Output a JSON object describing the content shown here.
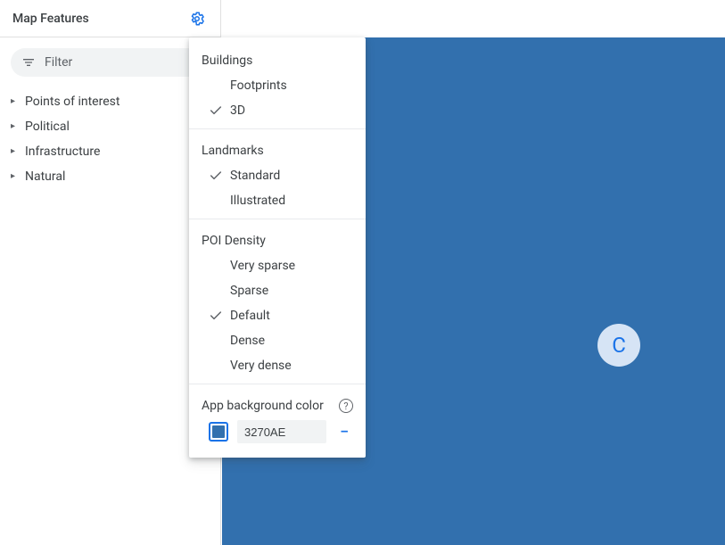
{
  "sidebar": {
    "title": "Map Features",
    "filter_placeholder": "Filter",
    "items": [
      {
        "label": "Points of interest"
      },
      {
        "label": "Political"
      },
      {
        "label": "Infrastructure"
      },
      {
        "label": "Natural"
      }
    ]
  },
  "settings": {
    "sections": [
      {
        "title": "Buildings",
        "options": [
          {
            "label": "Footprints",
            "selected": false
          },
          {
            "label": "3D",
            "selected": true
          }
        ]
      },
      {
        "title": "Landmarks",
        "options": [
          {
            "label": "Standard",
            "selected": true
          },
          {
            "label": "Illustrated",
            "selected": false
          }
        ]
      },
      {
        "title": "POI Density",
        "options": [
          {
            "label": "Very sparse",
            "selected": false
          },
          {
            "label": "Sparse",
            "selected": false
          },
          {
            "label": "Default",
            "selected": true
          },
          {
            "label": "Dense",
            "selected": false
          },
          {
            "label": "Very dense",
            "selected": false
          }
        ]
      }
    ],
    "bg_color_label": "App background color",
    "bg_color_hex": "3270AE"
  },
  "map": {
    "background": "#3270AE",
    "watermark_letter": "C"
  }
}
